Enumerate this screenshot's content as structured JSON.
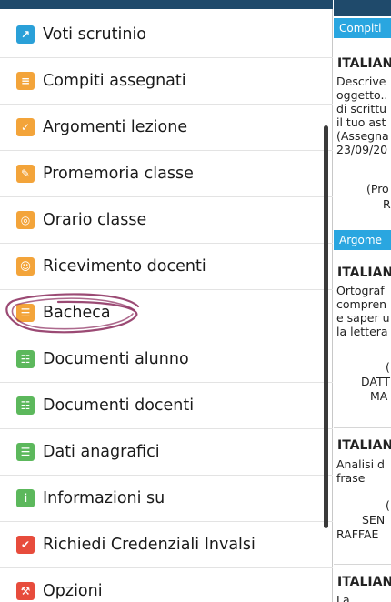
{
  "menu": [
    {
      "label": "Voti scrutinio",
      "icon": "grades-icon",
      "color": "#2aa0d8"
    },
    {
      "label": "Compiti assegnati",
      "icon": "homework-icon",
      "color": "#f3a43a"
    },
    {
      "label": "Argomenti lezione",
      "icon": "lesson-topics-icon",
      "color": "#f3a43a"
    },
    {
      "label": "Promemoria classe",
      "icon": "reminder-icon",
      "color": "#f3a43a"
    },
    {
      "label": "Orario classe",
      "icon": "clock-icon",
      "color": "#f3a43a"
    },
    {
      "label": "Ricevimento docenti",
      "icon": "teacher-meeting-icon",
      "color": "#f3a43a"
    },
    {
      "label": "Bacheca",
      "icon": "noticeboard-icon",
      "color": "#f3a43a"
    },
    {
      "label": "Documenti alunno",
      "icon": "student-docs-icon",
      "color": "#5cb85c"
    },
    {
      "label": "Documenti docenti",
      "icon": "teacher-docs-icon",
      "color": "#5cb85c"
    },
    {
      "label": "Dati anagrafici",
      "icon": "personal-data-icon",
      "color": "#5cb85c"
    },
    {
      "label": "Informazioni su",
      "icon": "info-icon",
      "color": "#5cb85c"
    },
    {
      "label": "Richiedi Credenziali Invalsi",
      "icon": "invalsi-icon",
      "color": "#e74c3c"
    },
    {
      "label": "Opzioni",
      "icon": "wrench-icon",
      "color": "#e74c3c"
    }
  ],
  "right": {
    "sec1_header": "Compiti",
    "sec1_title": "ITALIAN",
    "sec1_text": "Descrive\noggetto..\ndi scrittu\nil tuo ast\n(Assegna\n23/09/20",
    "sec1_author1": "(Pro",
    "sec1_author2": "R",
    "sec2_header": "Argome",
    "sec2_title": "ITALIAN",
    "sec2_text": "Ortograf\ncompren\ne saper u\nla lettera",
    "sec2_a1": "(",
    "sec2_a2": "DATT",
    "sec2_a3": "MA",
    "sec3_title": "ITALIAN",
    "sec3_text": "Analisi d\nfrase",
    "sec3_a1": "(",
    "sec3_a2": "SEN",
    "sec3_a3": "RAFFAE",
    "sec4_title": "ITALIAN",
    "sec4_text": "La"
  },
  "colors": {
    "accent": "#2aa6e0",
    "topbar": "#1f4a6b",
    "annotation": "#8a2a5c"
  }
}
